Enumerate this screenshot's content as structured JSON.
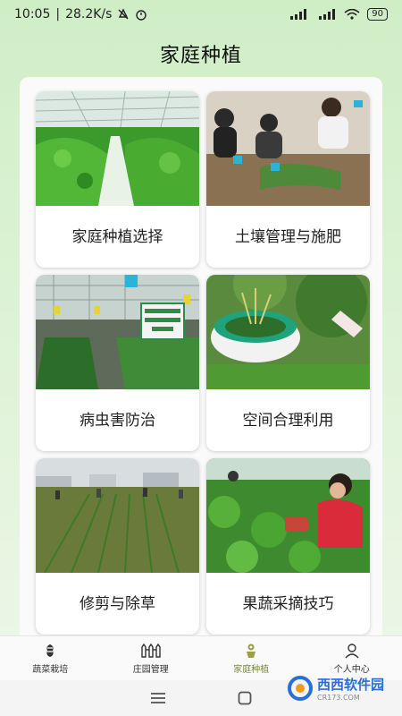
{
  "status": {
    "time": "10:05",
    "speed": "28.2K/s",
    "battery": "90"
  },
  "page_title": "家庭种植",
  "cards": [
    {
      "label": "家庭种植选择",
      "icon": "greenhouse-peppers-photo"
    },
    {
      "label": "土壤管理与施肥",
      "icon": "children-watering-photo"
    },
    {
      "label": "病虫害防治",
      "icon": "greenhouse-sign-photo"
    },
    {
      "label": "空间合理利用",
      "icon": "tire-planter-photo"
    },
    {
      "label": "修剪与除草",
      "icon": "field-workers-photo"
    },
    {
      "label": "果蔬采摘技巧",
      "icon": "strawberry-picking-photo"
    }
  ],
  "nav": [
    {
      "label": "蔬菜栽培",
      "icon": "vegetable-icon",
      "active": false
    },
    {
      "label": "庄园管理",
      "icon": "fence-icon",
      "active": false
    },
    {
      "label": "家庭种植",
      "icon": "flower-pot-icon",
      "active": true
    },
    {
      "label": "个人中心",
      "icon": "person-icon",
      "active": false
    }
  ],
  "watermark": {
    "brand": "西西软件园",
    "url": "CR173.COM"
  },
  "colors": {
    "accent": "#7a8a3a",
    "background_top": "#cfeec6"
  }
}
